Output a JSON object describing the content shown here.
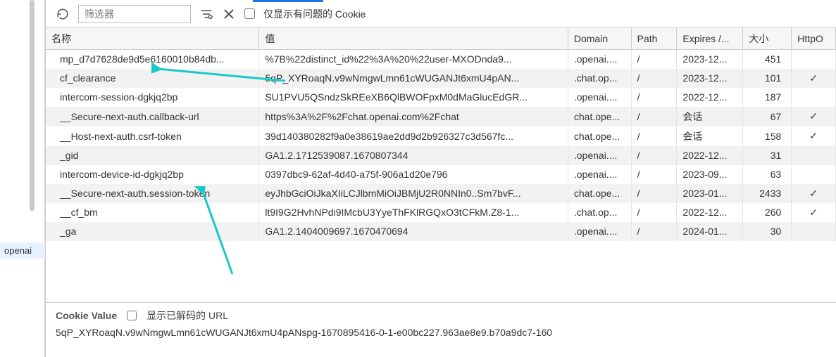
{
  "toolbar": {
    "filter_placeholder": "筛选器",
    "problem_only_label": "仅显示有问题的 Cookie"
  },
  "left_panel": {
    "selected_label": "openai"
  },
  "columns": {
    "name": "名称",
    "value": "值",
    "domain": "Domain",
    "path": "Path",
    "expires": "Expires /...",
    "size": "大小",
    "http_only": "HttpO"
  },
  "cookies": [
    {
      "name": "mp_d7d7628de9d5e6160010b84db...",
      "value": "%7B%22distinct_id%22%3A%20%22user-MXODnda9...",
      "domain": ".openai....",
      "path": "/",
      "expires": "2023-12...",
      "size": "451",
      "http": ""
    },
    {
      "name": "cf_clearance",
      "value": "5qP_XYRoaqN.v9wNmgwLmn61cWUGANJt6xmU4pAN...",
      "domain": ".chat.op...",
      "path": "/",
      "expires": "2023-12...",
      "size": "101",
      "http": "✓"
    },
    {
      "name": "intercom-session-dgkjq2bp",
      "value": "SU1PVU5QSndzSkREeXB6QlBWOFpxM0dMaGlucEdGR...",
      "domain": ".openai....",
      "path": "/",
      "expires": "2022-12...",
      "size": "187",
      "http": ""
    },
    {
      "name": "__Secure-next-auth.callback-url",
      "value": "https%3A%2F%2Fchat.openai.com%2Fchat",
      "domain": "chat.ope...",
      "path": "/",
      "expires": "会话",
      "size": "67",
      "http": "✓"
    },
    {
      "name": "__Host-next-auth.csrf-token",
      "value": "39d140380282f9a0e38619ae2dd9d2b926327c3d567fc...",
      "domain": "chat.ope...",
      "path": "/",
      "expires": "会话",
      "size": "158",
      "http": "✓"
    },
    {
      "name": "_gid",
      "value": "GA1.2.1712539087.1670807344",
      "domain": ".openai....",
      "path": "/",
      "expires": "2022-12...",
      "size": "31",
      "http": ""
    },
    {
      "name": "intercom-device-id-dgkjq2bp",
      "value": "0397dbc9-62af-4d40-a75f-906a1d20e796",
      "domain": ".openai....",
      "path": "/",
      "expires": "2023-09...",
      "size": "63",
      "http": ""
    },
    {
      "name": "__Secure-next-auth.session-token",
      "value": "eyJhbGciOiJkaXIiLCJlbmMiOiJBMjU2R0NNIn0..Sm7bvF...",
      "domain": "chat.ope...",
      "path": "/",
      "expires": "2023-01...",
      "size": "2433",
      "http": "✓"
    },
    {
      "name": "__cf_bm",
      "value": "lt9I9G2HvhNPdi9IMcbU3YyeThFKlRGQxO3tCFkM.Z8-1...",
      "domain": ".chat.op...",
      "path": "/",
      "expires": "2022-12...",
      "size": "260",
      "http": "✓"
    },
    {
      "name": "_ga",
      "value": "GA1.2.1404009697.1670470694",
      "domain": ".openai....",
      "path": "/",
      "expires": "2024-01...",
      "size": "30",
      "http": ""
    }
  ],
  "detail": {
    "label": "Cookie Value",
    "decode_label": "显示已解码的 URL",
    "value": "5qP_XYRoaqN.v9wNmgwLmn61cWUGANJt6xmU4pANspg-1670895416-0-1-e00bc227.963ae8e9.b70a9dc7-160"
  }
}
